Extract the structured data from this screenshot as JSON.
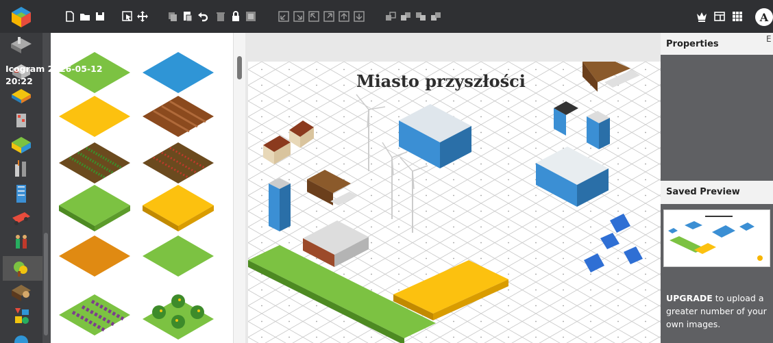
{
  "toolbar": {
    "left_icons": [
      "new-file-icon",
      "open-folder-icon",
      "save-icon",
      "select-icon",
      "move-icon",
      "copy-icon",
      "paste-icon",
      "undo-icon",
      "delete-icon",
      "lock-icon",
      "group-icon",
      "align-bottom-left-icon",
      "align-bottom-right-icon",
      "align-top-left-icon",
      "align-top-right-icon",
      "bring-to-front-icon",
      "send-to-back-icon",
      "arrange-1-icon",
      "arrange-2-icon",
      "arrange-3-icon",
      "arrange-4-icon"
    ],
    "right_icons": [
      "crown-icon",
      "layout-icon",
      "grid-icon"
    ],
    "avatar_letter": "A"
  },
  "categories": [
    "roads",
    "buildings",
    "vehicles",
    "cranes",
    "terrain",
    "industry",
    "towers",
    "transport",
    "people",
    "plants",
    "wood",
    "shapes"
  ],
  "palette": [
    "grass-tile",
    "water-tile",
    "sand-tile",
    "plowed-field-tile",
    "crops-tile",
    "crop-rows-tile",
    "green-grass-field",
    "wheat-field",
    "orange-field",
    "light-grass-tile",
    "vineyard",
    "orchard"
  ],
  "canvas": {
    "title": "Miasto przyszłości"
  },
  "properties": {
    "header": "Properties",
    "diagram_name": "Icogram 2026-05-12 20:22"
  },
  "saved_preview": {
    "header": "Saved Preview"
  },
  "upgrade": {
    "strong": "UPGRADE",
    "text": " to upload a greater number of your own images."
  },
  "colors": {
    "toolbar": "#2f3033",
    "sidebar": "#3a3b3e",
    "panel_dark": "#5f6063",
    "grass": "#7cc242",
    "water": "#2f95d6",
    "sand": "#fcc10f",
    "soil": "#8b4a1e"
  }
}
